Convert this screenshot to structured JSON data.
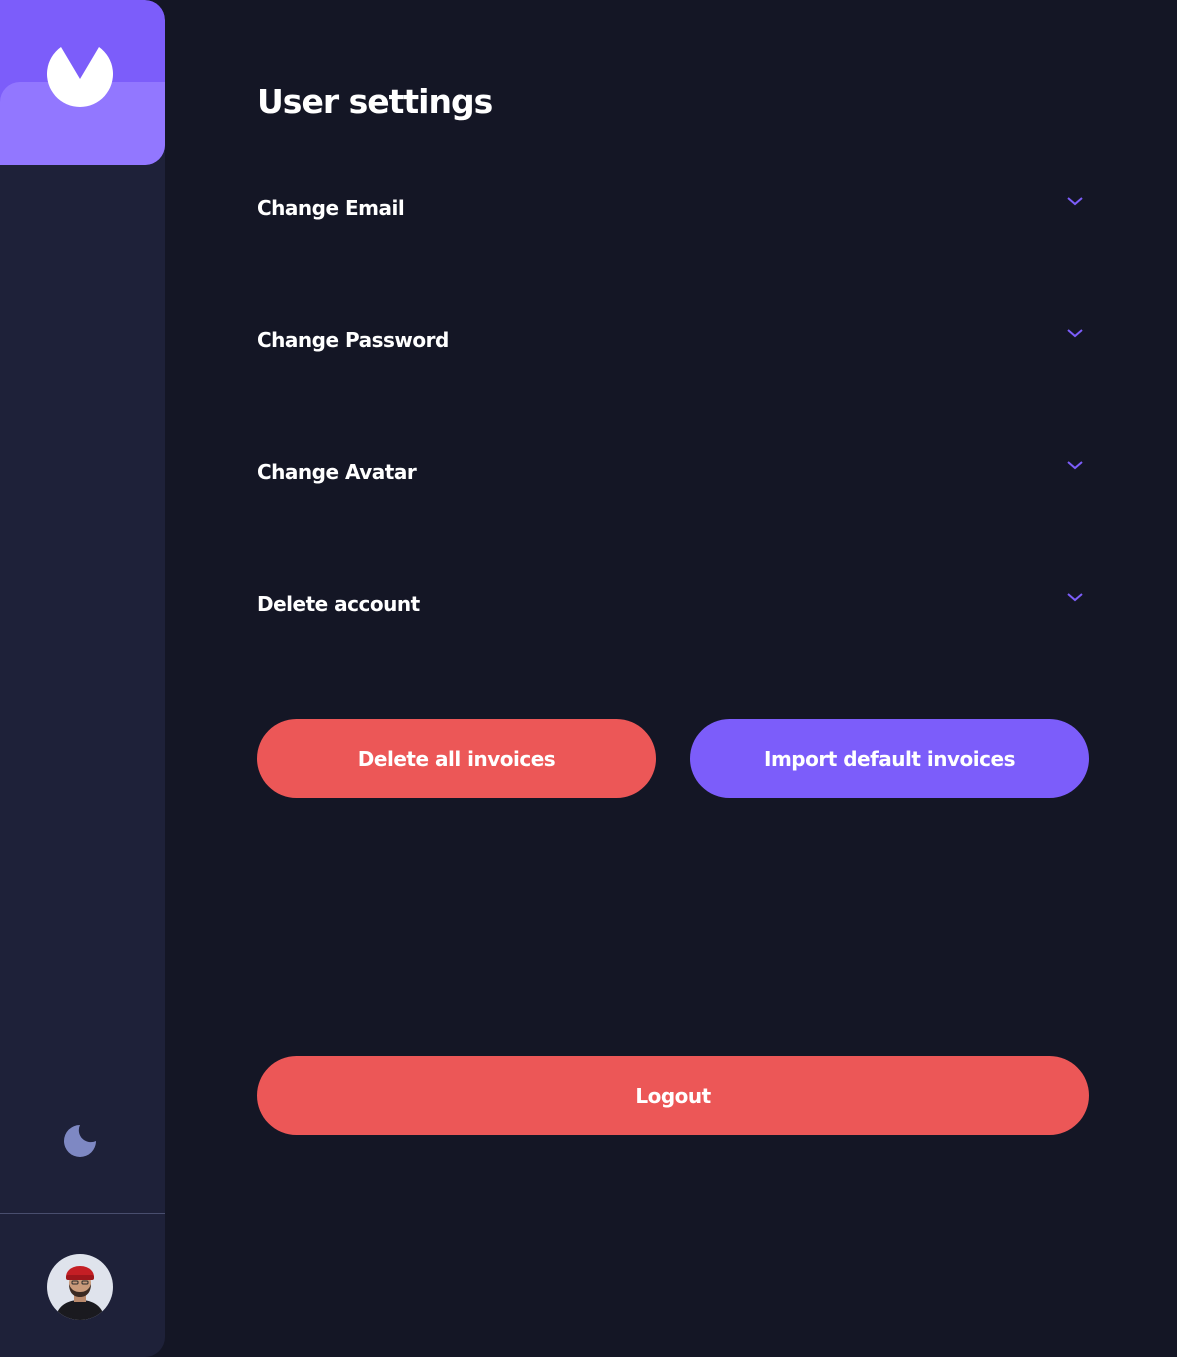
{
  "page": {
    "title": "User settings"
  },
  "settings": {
    "items": [
      {
        "label": "Change Email",
        "icon": "chevron-down-icon"
      },
      {
        "label": "Change Password",
        "icon": "chevron-down-icon"
      },
      {
        "label": "Change Avatar",
        "icon": "chevron-down-icon"
      },
      {
        "label": "Delete account",
        "icon": "chevron-down-icon"
      }
    ]
  },
  "actions": {
    "delete_all_invoices": "Delete all invoices",
    "import_default_invoices": "Import default invoices",
    "logout": "Logout"
  },
  "sidebar": {
    "logo_icon": "brand-logo-icon",
    "theme_icon": "moon-icon",
    "avatar": "user-avatar"
  },
  "colors": {
    "background": "#141625",
    "sidebar": "#1e2139",
    "accent": "#7c5dfa",
    "accent_light": "#9277ff",
    "danger": "#ec5757",
    "moon": "#7e88c3",
    "divider": "#494e6e"
  }
}
